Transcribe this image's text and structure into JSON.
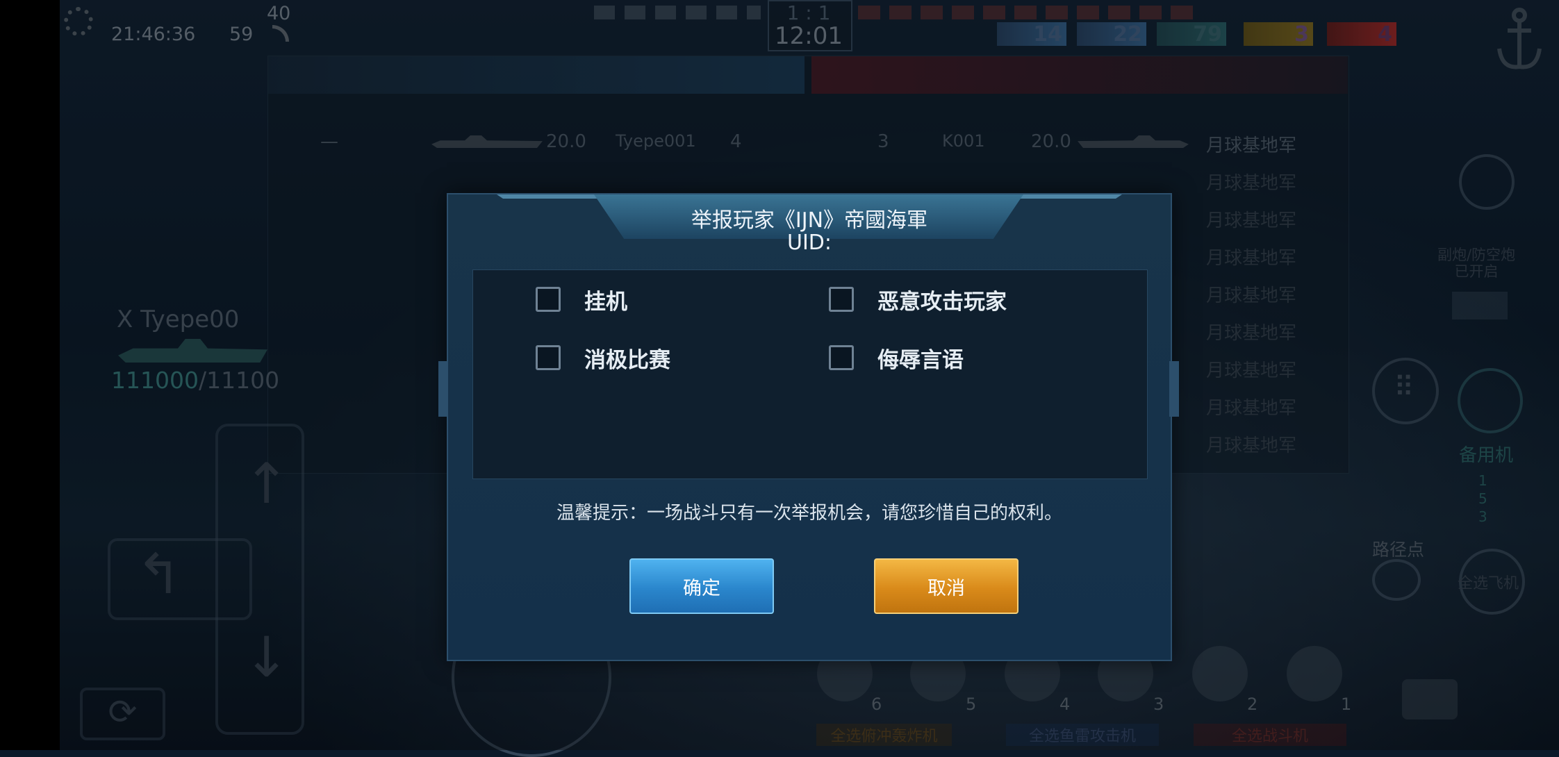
{
  "hud": {
    "clock": "21:46:36",
    "fps": "59",
    "ping": "40",
    "score": "1  :  1",
    "timer": "12:01",
    "team_counts": [
      "14",
      "22",
      "79",
      "3",
      "4"
    ]
  },
  "left_panel": {
    "ship_name": "X  Tyepe00",
    "hp_current": "111000",
    "hp_sep": "/",
    "hp_max": "11100"
  },
  "scoreboard": {
    "left_row": {
      "value": "20.0",
      "name": "Tyepe001",
      "rank": "4",
      "dash": "—"
    },
    "right_row": {
      "rank": "3",
      "name": "K001",
      "value": "20.0",
      "faction": "月球基地军"
    },
    "right_factions": [
      "月球基地军",
      "月球基地军",
      "月球基地军",
      "月球基地军",
      "月球基地军",
      "月球基地军",
      "月球基地军",
      "月球基地军",
      "月球基地军"
    ]
  },
  "dialog": {
    "title": "举报玩家《IJN》帝國海軍",
    "uid_label": "UID:",
    "reasons": [
      {
        "label": "挂机",
        "checked": false
      },
      {
        "label": "恶意攻击玩家",
        "checked": false
      },
      {
        "label": "消极比赛",
        "checked": false
      },
      {
        "label": "侮辱言语",
        "checked": false
      }
    ],
    "tip": "温馨提示：一场战斗只有一次举报机会，请您珍惜自己的权利。",
    "confirm_label": "确定",
    "cancel_label": "取消"
  },
  "right_hud": {
    "notice": "副炮/防空炮\n已开启",
    "reserve_label": "备用机",
    "waypoint_label": "路径点",
    "select_planes": "全选飞机",
    "counts": [
      "1",
      "5",
      "3"
    ]
  },
  "weapons": {
    "slots": [
      "6",
      "5",
      "4",
      "3",
      "2",
      "1"
    ],
    "group_labels": [
      "全选俯冲轰炸机",
      "全选鱼雷攻击机",
      "全选战斗机"
    ]
  },
  "colors": {
    "confirm": "#2a86cc",
    "cancel": "#d98a1a",
    "dialog_bg": "#14304a",
    "team_blue": "#3b6fa0",
    "team_red": "#b03030"
  }
}
